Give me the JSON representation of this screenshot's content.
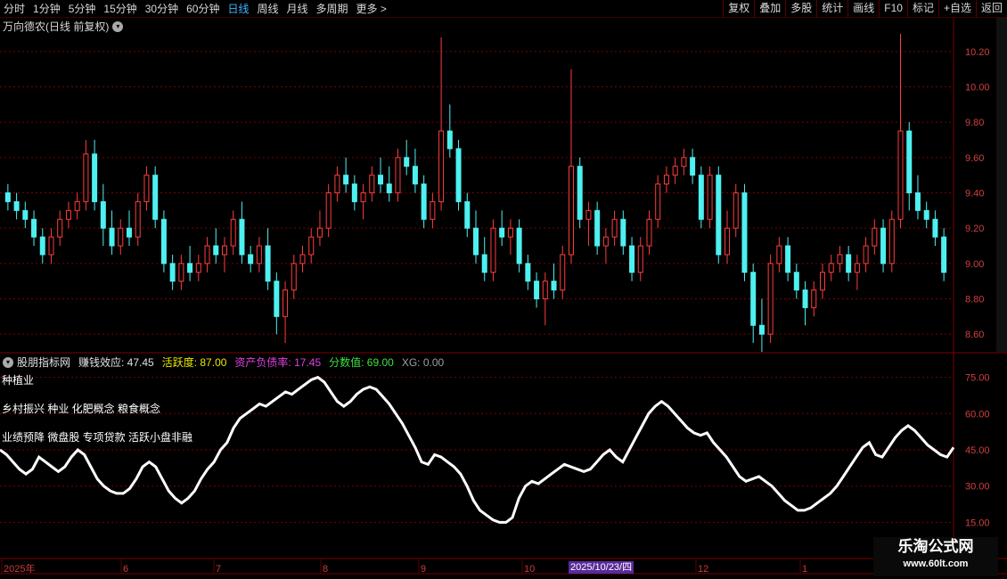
{
  "toolbar": {
    "periods": [
      "分时",
      "1分钟",
      "5分钟",
      "15分钟",
      "30分钟",
      "60分钟",
      "日线",
      "周线",
      "月线",
      "多周期",
      "更多 >"
    ],
    "active_period": "日线",
    "right_buttons": [
      "复权",
      "叠加",
      "多股",
      "统计",
      "画线",
      "F10",
      "标记",
      "+自选",
      "返回"
    ]
  },
  "stock": {
    "title": "万向德农(日线 前复权)"
  },
  "indicator": {
    "name": "股朋指标网",
    "fields": [
      {
        "label": "赚钱效应: 47.45",
        "color": "#e0e0e0"
      },
      {
        "label": "活跃度: 87.00",
        "color": "#e8e800"
      },
      {
        "label": "资产负债率: 17.45",
        "color": "#e040e0"
      },
      {
        "label": "分数值: 69.00",
        "color": "#40e040"
      },
      {
        "label": "XG: 0.00",
        "color": "#a0a0a0"
      }
    ],
    "lines": [
      "种植业",
      "乡村振兴 种业 化肥概念 粮食概念",
      "业绩预降 微盘股 专项贷款 活跃小盘非融"
    ]
  },
  "price_axis": [
    "10.20",
    "10.00",
    "9.80",
    "9.60",
    "9.40",
    "9.20",
    "9.00",
    "8.80",
    "8.60"
  ],
  "indicator_axis": [
    "75.00",
    "60.00",
    "45.00",
    "30.00",
    "15.00"
  ],
  "date_axis": [
    "2025年",
    "6",
    "7",
    "8",
    "9",
    "10",
    "12",
    "1"
  ],
  "date_highlight": "2025/10/23/四",
  "watermark": {
    "title": "乐淘公式网",
    "url": "www.60lt.com"
  },
  "colors": {
    "up": "#ff3c3c",
    "down": "#4ef0f0",
    "grid": "#7a0000",
    "line": "#ffffff"
  },
  "chart_data": {
    "type": "candlestick",
    "ylim": [
      8.5,
      10.3
    ],
    "indicator_ylim": [
      10,
      80
    ],
    "ohlc": [
      [
        9.4,
        9.45,
        9.3,
        9.35
      ],
      [
        9.35,
        9.4,
        9.25,
        9.3
      ],
      [
        9.3,
        9.35,
        9.2,
        9.25
      ],
      [
        9.25,
        9.3,
        9.1,
        9.15
      ],
      [
        9.15,
        9.2,
        9.0,
        9.05
      ],
      [
        9.05,
        9.2,
        9.0,
        9.15
      ],
      [
        9.15,
        9.3,
        9.1,
        9.25
      ],
      [
        9.25,
        9.35,
        9.2,
        9.3
      ],
      [
        9.3,
        9.4,
        9.25,
        9.35
      ],
      [
        9.35,
        9.7,
        9.3,
        9.62
      ],
      [
        9.62,
        9.7,
        9.3,
        9.35
      ],
      [
        9.35,
        9.45,
        9.1,
        9.2
      ],
      [
        9.2,
        9.3,
        9.05,
        9.1
      ],
      [
        9.1,
        9.25,
        9.05,
        9.2
      ],
      [
        9.2,
        9.3,
        9.1,
        9.15
      ],
      [
        9.15,
        9.4,
        9.1,
        9.35
      ],
      [
        9.35,
        9.55,
        9.3,
        9.5
      ],
      [
        9.5,
        9.55,
        9.2,
        9.25
      ],
      [
        9.25,
        9.3,
        8.95,
        9.0
      ],
      [
        9.0,
        9.05,
        8.85,
        8.9
      ],
      [
        8.9,
        9.05,
        8.85,
        9.0
      ],
      [
        9.0,
        9.1,
        8.9,
        8.95
      ],
      [
        8.95,
        9.05,
        8.9,
        9.0
      ],
      [
        9.0,
        9.15,
        8.95,
        9.1
      ],
      [
        9.1,
        9.2,
        9.0,
        9.05
      ],
      [
        9.05,
        9.15,
        8.95,
        9.1
      ],
      [
        9.1,
        9.3,
        9.05,
        9.25
      ],
      [
        9.25,
        9.35,
        9.0,
        9.05
      ],
      [
        9.05,
        9.1,
        8.95,
        9.0
      ],
      [
        9.0,
        9.15,
        8.95,
        9.1
      ],
      [
        9.1,
        9.2,
        8.85,
        8.9
      ],
      [
        8.9,
        8.95,
        8.6,
        8.7
      ],
      [
        8.7,
        8.9,
        8.55,
        8.85
      ],
      [
        8.85,
        9.05,
        8.8,
        9.0
      ],
      [
        9.0,
        9.1,
        8.95,
        9.05
      ],
      [
        9.05,
        9.2,
        9.0,
        9.15
      ],
      [
        9.15,
        9.3,
        9.1,
        9.2
      ],
      [
        9.2,
        9.45,
        9.15,
        9.4
      ],
      [
        9.4,
        9.55,
        9.35,
        9.5
      ],
      [
        9.5,
        9.6,
        9.4,
        9.45
      ],
      [
        9.45,
        9.5,
        9.3,
        9.35
      ],
      [
        9.35,
        9.45,
        9.25,
        9.4
      ],
      [
        9.4,
        9.55,
        9.35,
        9.5
      ],
      [
        9.5,
        9.6,
        9.4,
        9.45
      ],
      [
        9.45,
        9.55,
        9.35,
        9.4
      ],
      [
        9.4,
        9.65,
        9.35,
        9.6
      ],
      [
        9.6,
        9.7,
        9.5,
        9.55
      ],
      [
        9.55,
        9.65,
        9.4,
        9.45
      ],
      [
        9.45,
        9.5,
        9.2,
        9.25
      ],
      [
        9.25,
        9.4,
        9.2,
        9.35
      ],
      [
        9.35,
        10.28,
        9.3,
        9.75
      ],
      [
        9.75,
        9.9,
        9.6,
        9.65
      ],
      [
        9.65,
        9.7,
        9.3,
        9.35
      ],
      [
        9.35,
        9.4,
        9.15,
        9.2
      ],
      [
        9.2,
        9.3,
        9.0,
        9.05
      ],
      [
        9.05,
        9.15,
        8.9,
        8.95
      ],
      [
        8.95,
        9.25,
        8.9,
        9.2
      ],
      [
        9.2,
        9.3,
        9.1,
        9.15
      ],
      [
        9.15,
        9.25,
        9.05,
        9.2
      ],
      [
        9.2,
        9.25,
        8.95,
        9.0
      ],
      [
        9.0,
        9.05,
        8.85,
        8.9
      ],
      [
        8.9,
        8.95,
        8.75,
        8.8
      ],
      [
        8.8,
        8.95,
        8.65,
        8.9
      ],
      [
        8.9,
        9.0,
        8.8,
        8.85
      ],
      [
        8.85,
        9.1,
        8.8,
        9.05
      ],
      [
        9.05,
        10.1,
        9.0,
        9.55
      ],
      [
        9.55,
        9.6,
        9.2,
        9.25
      ],
      [
        9.25,
        9.35,
        9.1,
        9.3
      ],
      [
        9.3,
        9.35,
        9.05,
        9.1
      ],
      [
        9.1,
        9.2,
        9.0,
        9.15
      ],
      [
        9.15,
        9.3,
        9.1,
        9.25
      ],
      [
        9.25,
        9.3,
        9.05,
        9.1
      ],
      [
        9.1,
        9.15,
        8.9,
        8.95
      ],
      [
        8.95,
        9.15,
        8.9,
        9.1
      ],
      [
        9.1,
        9.3,
        9.05,
        9.25
      ],
      [
        9.25,
        9.5,
        9.2,
        9.45
      ],
      [
        9.45,
        9.55,
        9.4,
        9.5
      ],
      [
        9.5,
        9.6,
        9.45,
        9.55
      ],
      [
        9.55,
        9.65,
        9.5,
        9.6
      ],
      [
        9.6,
        9.65,
        9.45,
        9.5
      ],
      [
        9.5,
        9.55,
        9.2,
        9.25
      ],
      [
        9.25,
        9.55,
        9.2,
        9.5
      ],
      [
        9.5,
        9.55,
        9.0,
        9.05
      ],
      [
        9.05,
        9.3,
        9.0,
        9.2
      ],
      [
        9.2,
        9.45,
        9.15,
        9.4
      ],
      [
        9.4,
        9.45,
        8.9,
        8.95
      ],
      [
        8.95,
        9.0,
        8.55,
        8.65
      ],
      [
        8.65,
        8.8,
        8.5,
        8.6
      ],
      [
        8.6,
        9.05,
        8.55,
        9.0
      ],
      [
        9.0,
        9.15,
        8.95,
        9.1
      ],
      [
        9.1,
        9.15,
        8.9,
        8.95
      ],
      [
        8.95,
        9.0,
        8.8,
        8.85
      ],
      [
        8.85,
        8.9,
        8.65,
        8.75
      ],
      [
        8.75,
        8.9,
        8.7,
        8.85
      ],
      [
        8.85,
        9.0,
        8.8,
        8.95
      ],
      [
        8.95,
        9.05,
        8.9,
        9.0
      ],
      [
        9.0,
        9.1,
        8.95,
        9.05
      ],
      [
        9.05,
        9.1,
        8.9,
        8.95
      ],
      [
        8.95,
        9.05,
        8.85,
        9.0
      ],
      [
        9.0,
        9.15,
        8.95,
        9.1
      ],
      [
        9.1,
        9.25,
        9.05,
        9.2
      ],
      [
        9.2,
        9.25,
        8.95,
        9.0
      ],
      [
        9.0,
        9.3,
        8.95,
        9.25
      ],
      [
        9.25,
        10.3,
        9.2,
        9.75
      ],
      [
        9.75,
        9.8,
        9.3,
        9.4
      ],
      [
        9.4,
        9.5,
        9.25,
        9.3
      ],
      [
        9.3,
        9.35,
        9.2,
        9.25
      ],
      [
        9.25,
        9.3,
        9.1,
        9.15
      ],
      [
        9.15,
        9.2,
        8.9,
        8.95
      ]
    ],
    "indicator_values": [
      45,
      43,
      40,
      37,
      35,
      37,
      42,
      40,
      38,
      36,
      38,
      42,
      45,
      43,
      38,
      33,
      30,
      28,
      27,
      27,
      29,
      33,
      38,
      40,
      38,
      33,
      28,
      25,
      23,
      25,
      28,
      33,
      37,
      40,
      45,
      48,
      54,
      58,
      60,
      62,
      64,
      63,
      65,
      67,
      69,
      68,
      70,
      72,
      74,
      75,
      73,
      69,
      65,
      63,
      65,
      68,
      70,
      71,
      70,
      67,
      64,
      60,
      56,
      51,
      46,
      40,
      39,
      43,
      42,
      40,
      38,
      35,
      30,
      24,
      20,
      18,
      16,
      15,
      15,
      17,
      25,
      30,
      32,
      31,
      33,
      35,
      37,
      39,
      38,
      37,
      36,
      37,
      40,
      43,
      45,
      42,
      40,
      45,
      50,
      55,
      60,
      63,
      65,
      63,
      60,
      57,
      54,
      52,
      51,
      52,
      48,
      45,
      42,
      38,
      34,
      32,
      33,
      34,
      32,
      30,
      27,
      24,
      22,
      20,
      20,
      21,
      23,
      25,
      27,
      30,
      34,
      38,
      42,
      46,
      48,
      43,
      42,
      46,
      50,
      53,
      55,
      53,
      50,
      47,
      45,
      43,
      42,
      46
    ]
  }
}
